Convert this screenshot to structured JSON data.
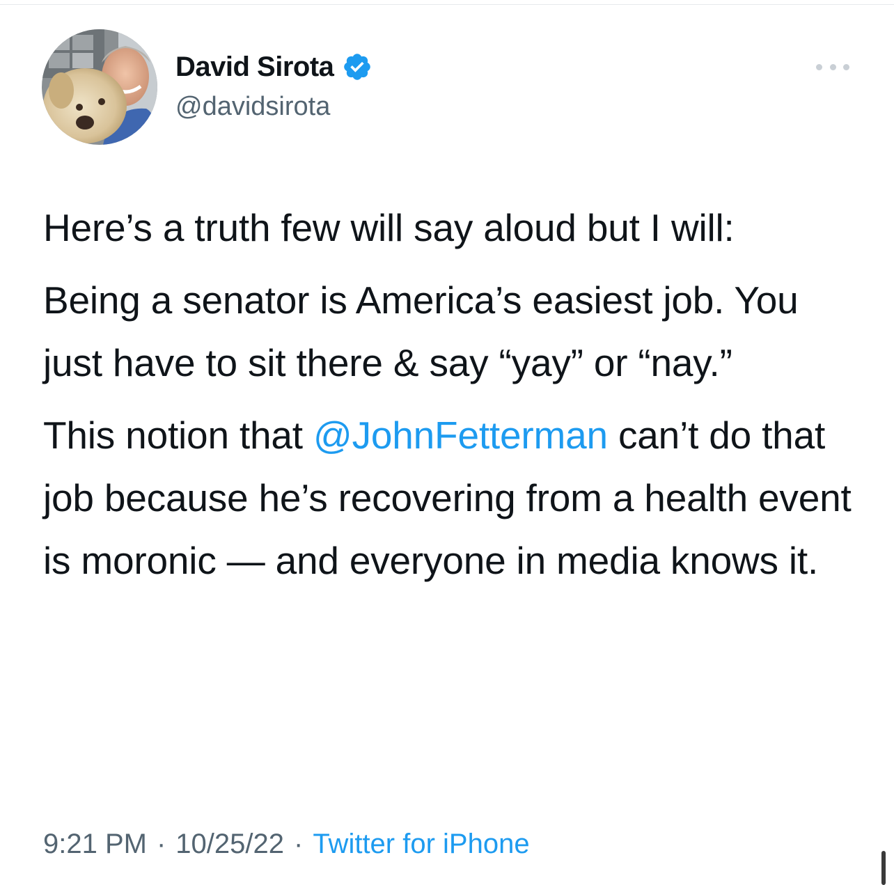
{
  "author": {
    "display_name": "David Sirota",
    "handle": "@davidsirota",
    "verified": true
  },
  "tweet": {
    "paragraphs": [
      {
        "text": "Here’s a truth few will say aloud but I will:"
      },
      {
        "text": "Being a senator is America’s easiest job. You just have to sit there & say “yay” or “nay.”"
      },
      {
        "before": "This notion that ",
        "mention": "@JohnFetterman",
        "after": " can’t do that job because he’s recovering from a health event is moronic — and everyone in media knows it."
      }
    ]
  },
  "meta": {
    "time": "9:21 PM",
    "separator": "·",
    "date": "10/25/22",
    "source": "Twitter for iPhone"
  },
  "icons": {
    "verified": "verified-badge-icon",
    "more": "more-options-icon"
  },
  "colors": {
    "accent": "#1d9bf0",
    "text": "#0f1419",
    "secondary": "#536471"
  }
}
